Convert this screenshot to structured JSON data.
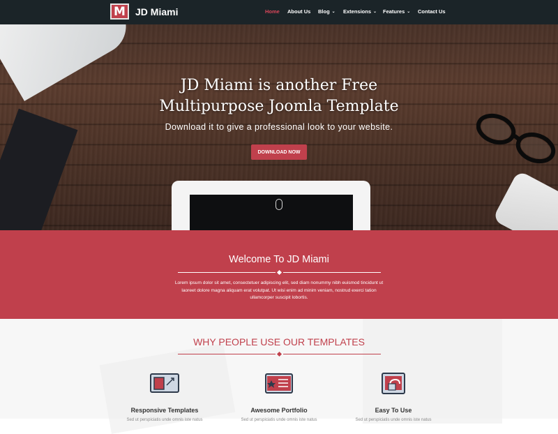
{
  "brand": {
    "logo_letter": "M",
    "name": "JD Miami",
    "accent": "#c0404c"
  },
  "nav": {
    "items": [
      {
        "label": "Home",
        "active": true,
        "dropdown": false
      },
      {
        "label": "About Us",
        "active": false,
        "dropdown": false
      },
      {
        "label": "Blog",
        "active": false,
        "dropdown": true
      },
      {
        "label": "Extensions",
        "active": false,
        "dropdown": true
      },
      {
        "label": "Features",
        "active": false,
        "dropdown": true
      },
      {
        "label": "Contact Us",
        "active": false,
        "dropdown": false
      }
    ]
  },
  "hero": {
    "title_line1": "JD Miami is another Free",
    "title_line2": "Multipurpose Joomla Template",
    "subtitle": "Download it to give a professional look to your website.",
    "button": "DOWNLOAD NOW"
  },
  "welcome": {
    "title": "Welcome To JD Miami",
    "text": "Lorem ipsum dolor sit amet, consectetuer adipiscing elit, sed diam nonummy nibh euismod tincidunt ut laoreet dolore magna aliquam erat volutpat. Ut wisi enim ad minim veniam, nostrud exerci tation ullamcorper suscipit lobortis."
  },
  "why": {
    "title": "WHY PEOPLE USE OUR TEMPLATES",
    "features": [
      {
        "title": "Responsive Templates",
        "desc": "Sed ut perspiciatis unde omnis iste natus",
        "icon": "responsive-icon"
      },
      {
        "title": "Awesome Portfolio",
        "desc": "Sed ut perspiciatis unde omnis iste natus",
        "icon": "portfolio-icon"
      },
      {
        "title": "Easy To Use",
        "desc": "Sed ut perspiciatis unde omnis iste natus",
        "icon": "easy-use-icon"
      }
    ]
  }
}
